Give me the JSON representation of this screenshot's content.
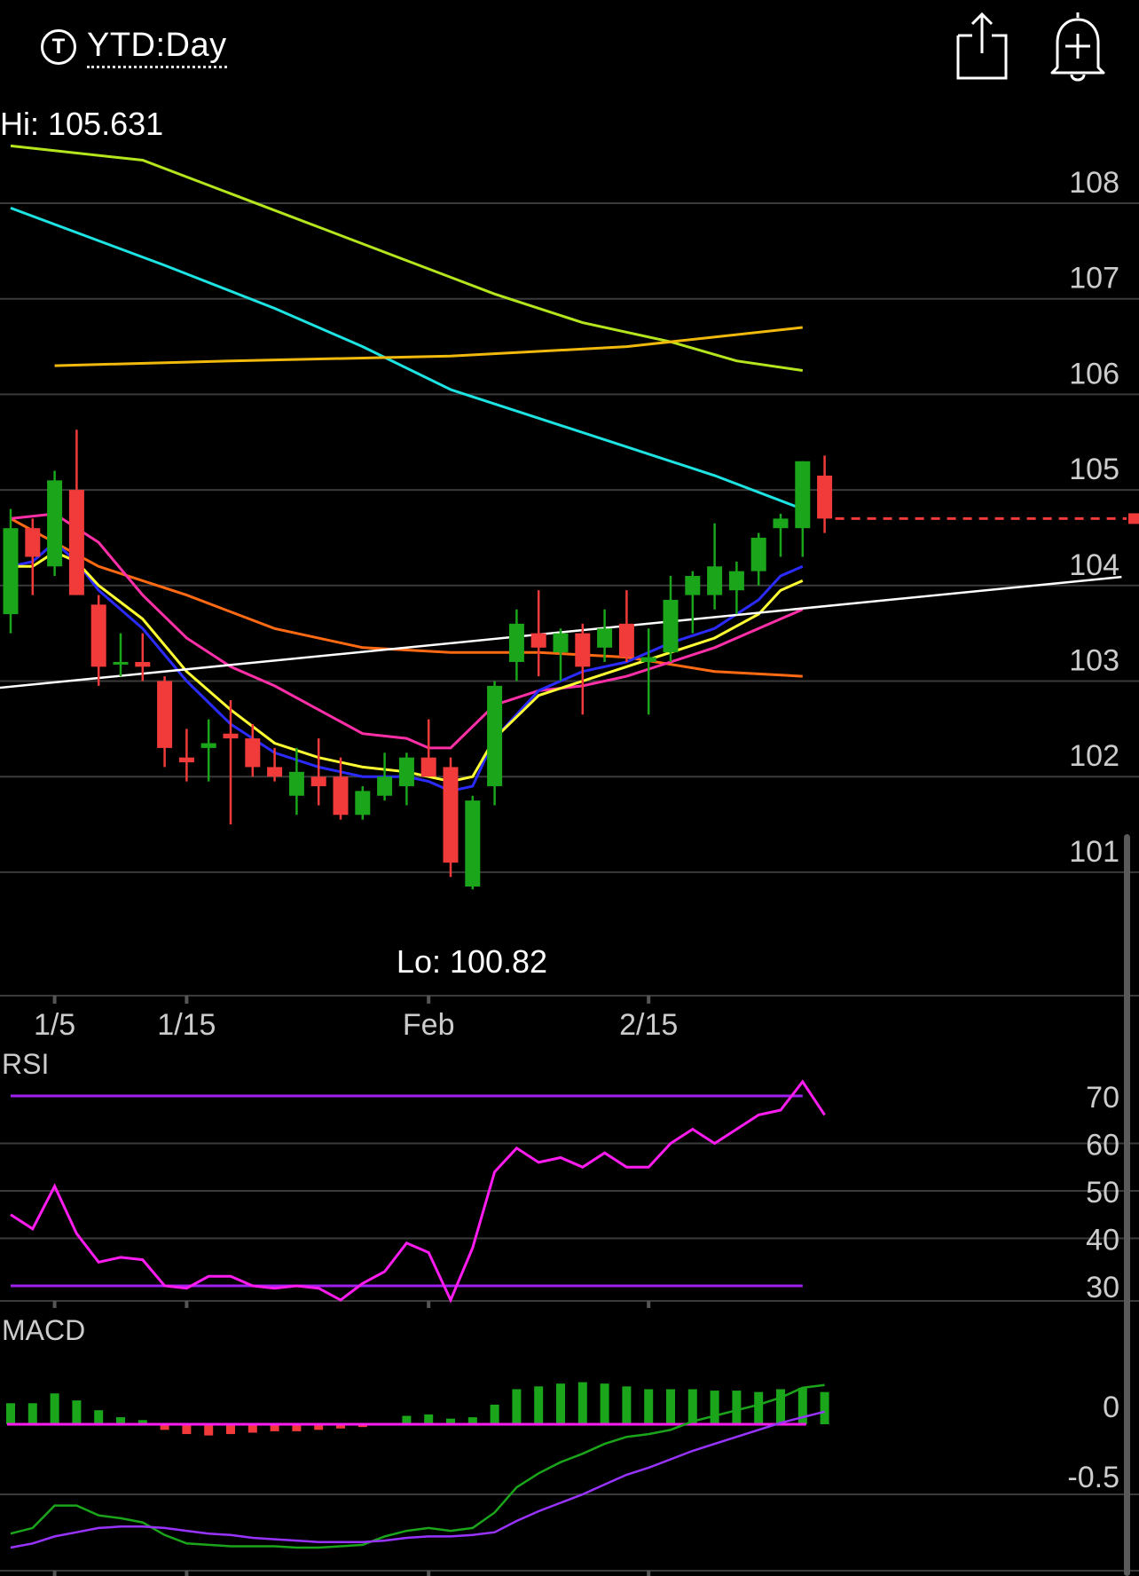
{
  "header": {
    "period_icon_letter": "T",
    "period_label": "YTD:Day",
    "share_icon": "share-icon",
    "alert_icon": "bell-plus-icon"
  },
  "chart_data": [
    {
      "type": "candlestick",
      "ylim": [
        100.0,
        109.0
      ],
      "y_ticks": [
        "108",
        "107",
        "106",
        "105",
        "104",
        "103",
        "102",
        "101"
      ],
      "y_tick_values": [
        108,
        107,
        106,
        105,
        104,
        103,
        102,
        101
      ],
      "x_ticks": [
        {
          "label": "1/5",
          "index": 2
        },
        {
          "label": "1/15",
          "index": 8
        },
        {
          "label": "Feb",
          "index": 19
        },
        {
          "label": "2/15",
          "index": 29
        }
      ],
      "hi_label": "Hi: 105.631",
      "lo_label": "Lo: 100.82",
      "colors": {
        "up": "#1aa51a",
        "down": "#f13a3a"
      },
      "candles": [
        {
          "o": 103.7,
          "h": 104.8,
          "l": 103.5,
          "c": 104.6
        },
        {
          "o": 104.6,
          "h": 104.7,
          "l": 103.9,
          "c": 104.3
        },
        {
          "o": 104.2,
          "h": 105.2,
          "l": 104.1,
          "c": 105.1
        },
        {
          "o": 105.0,
          "h": 105.63,
          "l": 103.9,
          "c": 103.9
        },
        {
          "o": 103.8,
          "h": 103.9,
          "l": 102.95,
          "c": 103.15
        },
        {
          "o": 103.2,
          "h": 103.5,
          "l": 103.05,
          "c": 103.2
        },
        {
          "o": 103.2,
          "h": 103.5,
          "l": 103.0,
          "c": 103.15
        },
        {
          "o": 103.0,
          "h": 103.05,
          "l": 102.1,
          "c": 102.3
        },
        {
          "o": 102.2,
          "h": 102.5,
          "l": 101.95,
          "c": 102.15
        },
        {
          "o": 102.3,
          "h": 102.6,
          "l": 101.95,
          "c": 102.35
        },
        {
          "o": 102.45,
          "h": 102.8,
          "l": 101.5,
          "c": 102.4
        },
        {
          "o": 102.4,
          "h": 102.55,
          "l": 102.0,
          "c": 102.1
        },
        {
          "o": 102.1,
          "h": 102.3,
          "l": 101.95,
          "c": 102.0
        },
        {
          "o": 101.8,
          "h": 102.3,
          "l": 101.6,
          "c": 102.05
        },
        {
          "o": 102.0,
          "h": 102.4,
          "l": 101.7,
          "c": 101.9
        },
        {
          "o": 102.0,
          "h": 102.2,
          "l": 101.55,
          "c": 101.6
        },
        {
          "o": 101.6,
          "h": 101.9,
          "l": 101.55,
          "c": 101.85
        },
        {
          "o": 101.8,
          "h": 102.25,
          "l": 101.75,
          "c": 102.0
        },
        {
          "o": 101.9,
          "h": 102.25,
          "l": 101.7,
          "c": 102.2
        },
        {
          "o": 102.2,
          "h": 102.6,
          "l": 102.0,
          "c": 102.0
        },
        {
          "o": 102.1,
          "h": 102.2,
          "l": 100.95,
          "c": 101.1
        },
        {
          "o": 100.85,
          "h": 101.8,
          "l": 100.82,
          "c": 101.75
        },
        {
          "o": 101.9,
          "h": 103.0,
          "l": 101.7,
          "c": 102.95
        },
        {
          "o": 103.2,
          "h": 103.75,
          "l": 103.0,
          "c": 103.6
        },
        {
          "o": 103.5,
          "h": 103.95,
          "l": 103.05,
          "c": 103.35
        },
        {
          "o": 103.3,
          "h": 103.55,
          "l": 103.0,
          "c": 103.5
        },
        {
          "o": 103.5,
          "h": 103.6,
          "l": 102.65,
          "c": 103.15
        },
        {
          "o": 103.35,
          "h": 103.75,
          "l": 103.2,
          "c": 103.55
        },
        {
          "o": 103.6,
          "h": 103.95,
          "l": 103.2,
          "c": 103.25
        },
        {
          "o": 103.2,
          "h": 103.55,
          "l": 102.65,
          "c": 103.25
        },
        {
          "o": 103.3,
          "h": 104.1,
          "l": 103.2,
          "c": 103.85
        },
        {
          "o": 103.9,
          "h": 104.15,
          "l": 103.5,
          "c": 104.1
        },
        {
          "o": 103.9,
          "h": 104.65,
          "l": 103.75,
          "c": 104.2
        },
        {
          "o": 103.95,
          "h": 104.25,
          "l": 103.7,
          "c": 104.15
        },
        {
          "o": 104.15,
          "h": 104.55,
          "l": 104.0,
          "c": 104.5
        },
        {
          "o": 104.6,
          "h": 104.75,
          "l": 104.3,
          "c": 104.7
        },
        {
          "o": 104.6,
          "h": 105.3,
          "l": 104.3,
          "c": 105.3
        },
        {
          "o": 105.15,
          "h": 105.36,
          "l": 104.55,
          "c": 104.7
        }
      ],
      "last_price": 104.7,
      "moving_averages": [
        {
          "color": "#b5e61d",
          "x": [
            0,
            6,
            10,
            14,
            18,
            22,
            26,
            30,
            33,
            36
          ],
          "y": [
            108.6,
            108.45,
            108.1,
            107.75,
            107.4,
            107.05,
            106.75,
            106.55,
            106.35,
            106.25
          ]
        },
        {
          "color": "#1ee3e3",
          "x": [
            0,
            7,
            12,
            16,
            20,
            24,
            28,
            32,
            36
          ],
          "y": [
            107.95,
            107.35,
            106.9,
            106.5,
            106.05,
            105.75,
            105.45,
            105.15,
            104.8
          ]
        },
        {
          "color": "#f0b90b",
          "x": [
            2,
            10,
            20,
            28,
            36
          ],
          "y": [
            106.3,
            106.35,
            106.4,
            106.5,
            106.7
          ]
        },
        {
          "color": "#ff6a13",
          "x": [
            0,
            4,
            8,
            12,
            16,
            20,
            24,
            28,
            32,
            36
          ],
          "y": [
            104.7,
            104.2,
            103.9,
            103.55,
            103.35,
            103.3,
            103.3,
            103.25,
            103.1,
            103.05
          ]
        },
        {
          "color": "#ff2fa8",
          "x": [
            0,
            2,
            4,
            6,
            8,
            10,
            12,
            14,
            16,
            18,
            19,
            20,
            22,
            24,
            26,
            28,
            30,
            32,
            34,
            36
          ],
          "y": [
            104.7,
            104.75,
            104.45,
            103.9,
            103.45,
            103.15,
            102.95,
            102.7,
            102.45,
            102.4,
            102.3,
            102.3,
            102.75,
            102.9,
            102.95,
            103.05,
            103.2,
            103.35,
            103.55,
            103.75
          ]
        },
        {
          "color": "#2b2bff",
          "x": [
            0,
            1,
            2,
            3,
            4,
            6,
            8,
            10,
            12,
            14,
            16,
            18,
            19,
            20,
            21,
            22,
            24,
            26,
            28,
            30,
            32,
            34,
            35,
            36
          ],
          "y": [
            104.2,
            104.25,
            104.45,
            104.25,
            103.95,
            103.55,
            103.0,
            102.55,
            102.25,
            102.1,
            102.0,
            102.0,
            101.95,
            101.85,
            101.9,
            102.4,
            102.9,
            103.1,
            103.2,
            103.4,
            103.55,
            103.85,
            104.1,
            104.2
          ]
        },
        {
          "color": "#ffff33",
          "x": [
            0,
            1,
            2,
            3,
            4,
            6,
            8,
            10,
            12,
            14,
            16,
            18,
            19,
            20,
            21,
            22,
            24,
            26,
            28,
            30,
            32,
            34,
            35,
            36
          ],
          "y": [
            104.2,
            104.2,
            104.35,
            104.25,
            104.0,
            103.65,
            103.1,
            102.7,
            102.35,
            102.2,
            102.1,
            102.05,
            102.0,
            101.95,
            102.0,
            102.4,
            102.85,
            103.0,
            103.15,
            103.3,
            103.45,
            103.7,
            103.95,
            104.05
          ]
        }
      ],
      "trendline": {
        "color": "#ffffff",
        "x": [
          -0.5,
          50.5
        ],
        "y": [
          102.93,
          104.09
        ]
      }
    },
    {
      "type": "line",
      "title": "RSI",
      "ylim": [
        20,
        78
      ],
      "y_ticks": [
        "70",
        "60",
        "50",
        "40",
        "30"
      ],
      "y_tick_values": [
        70,
        60,
        50,
        40,
        30
      ],
      "bands": [
        {
          "value": 70,
          "color": "#a020f0"
        },
        {
          "value": 30,
          "color": "#a020f0"
        }
      ],
      "series": [
        {
          "color": "#ff1cf0",
          "values": [
            45,
            42,
            51,
            41,
            35,
            36,
            35.5,
            30,
            29.5,
            32,
            32,
            30,
            29.5,
            30,
            29.5,
            27,
            30.5,
            33,
            39,
            37,
            27,
            38,
            54,
            59,
            56,
            57,
            55,
            58,
            55,
            55,
            60,
            63,
            60,
            63,
            66,
            67,
            73,
            66
          ]
        }
      ]
    },
    {
      "type": "bar+line",
      "title": "MACD",
      "ylim": [
        -1.05,
        0.28
      ],
      "y_ticks": [
        "0",
        "-0.5"
      ],
      "y_tick_values": [
        0,
        -0.5
      ],
      "histogram": {
        "up_color": "#1aa51a",
        "down_color": "#f13a3a",
        "values": [
          0.15,
          0.15,
          0.22,
          0.17,
          0.1,
          0.05,
          0.03,
          -0.04,
          -0.07,
          -0.08,
          -0.07,
          -0.06,
          -0.05,
          -0.05,
          -0.04,
          -0.03,
          -0.02,
          0,
          0.06,
          0.07,
          0.04,
          0.05,
          0.14,
          0.25,
          0.27,
          0.29,
          0.3,
          0.29,
          0.27,
          0.25,
          0.25,
          0.25,
          0.24,
          0.24,
          0.23,
          0.25,
          0.26,
          0.23
        ]
      },
      "series": [
        {
          "color": "#1aa51a",
          "values": [
            -0.78,
            -0.74,
            -0.58,
            -0.58,
            -0.65,
            -0.67,
            -0.7,
            -0.79,
            -0.85,
            -0.86,
            -0.87,
            -0.87,
            -0.87,
            -0.88,
            -0.88,
            -0.87,
            -0.86,
            -0.8,
            -0.76,
            -0.74,
            -0.76,
            -0.74,
            -0.63,
            -0.45,
            -0.35,
            -0.27,
            -0.21,
            -0.14,
            -0.09,
            -0.07,
            -0.04,
            0.02,
            0.06,
            0.1,
            0.14,
            0.19,
            0.26,
            0.28
          ]
        },
        {
          "color": "#9933ff",
          "values": [
            -0.88,
            -0.85,
            -0.8,
            -0.77,
            -0.74,
            -0.73,
            -0.73,
            -0.74,
            -0.76,
            -0.78,
            -0.79,
            -0.81,
            -0.82,
            -0.83,
            -0.84,
            -0.84,
            -0.84,
            -0.83,
            -0.81,
            -0.8,
            -0.8,
            -0.79,
            -0.77,
            -0.69,
            -0.62,
            -0.56,
            -0.5,
            -0.43,
            -0.36,
            -0.31,
            -0.25,
            -0.19,
            -0.14,
            -0.09,
            -0.04,
            0.01,
            0.05,
            0.09
          ]
        }
      ]
    }
  ]
}
